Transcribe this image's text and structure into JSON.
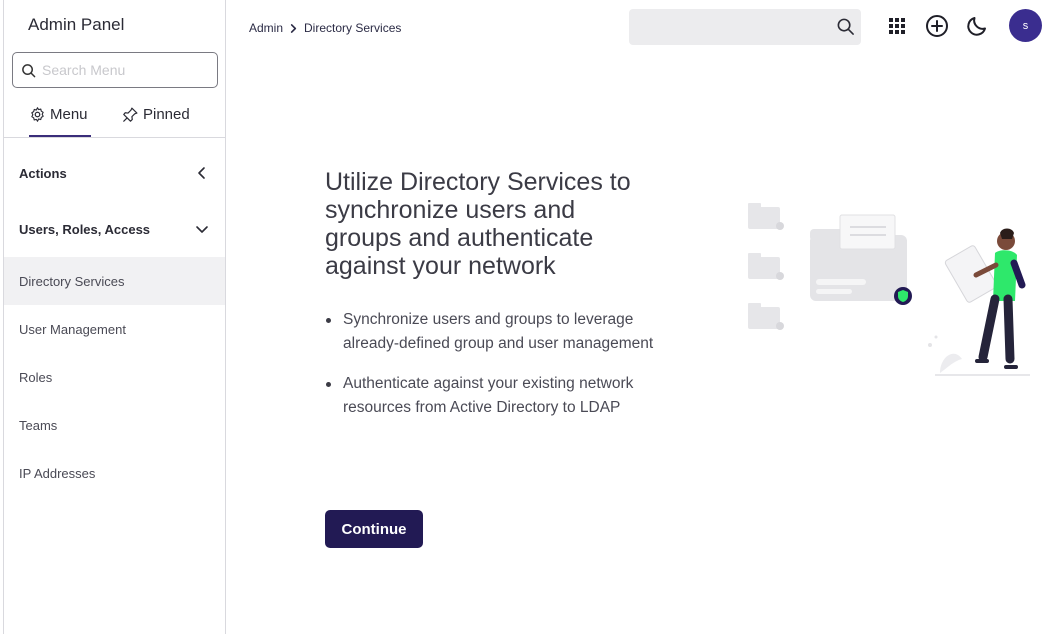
{
  "sidebar": {
    "title": "Admin Panel",
    "search_placeholder": "Search Menu",
    "tabs": [
      {
        "label": "Menu",
        "icon": "gear-icon"
      },
      {
        "label": "Pinned",
        "icon": "pin-icon"
      }
    ],
    "groups": {
      "actions": "Actions",
      "users": "Users, Roles, Access"
    },
    "items": [
      {
        "label": "Directory Services",
        "active": true
      },
      {
        "label": "User Management"
      },
      {
        "label": "Roles"
      },
      {
        "label": "Teams"
      },
      {
        "label": "IP Addresses"
      }
    ]
  },
  "header": {
    "breadcrumb": [
      "Admin",
      "Directory Services"
    ],
    "search_placeholder": "",
    "icons": [
      "apps-grid-icon",
      "add-circle-icon",
      "moon-icon",
      "search-icon"
    ],
    "avatar_initial": "s"
  },
  "main": {
    "headline": "Utilize Directory Services to synchronize users and groups and authenticate against your network",
    "bullets": [
      "Synchronize users and groups to leverage already-defined group and user management",
      "Authenticate against your existing network resources from Active Directory to LDAP"
    ],
    "continue_label": "Continue"
  },
  "colors": {
    "primary": "#221a54",
    "avatar": "#3a2d8f",
    "accent_green": "#2ee86b",
    "active_bg": "#f1f1f3"
  }
}
